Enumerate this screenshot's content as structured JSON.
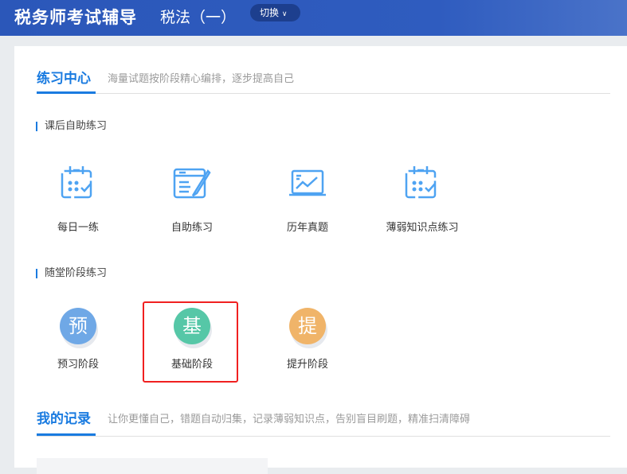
{
  "header": {
    "brand": "税务师考试辅导",
    "subject": "税法（一）",
    "switch_label": "切换"
  },
  "practice": {
    "title": "练习中心",
    "desc": "海量试题按阶段精心编排，逐步提高自己",
    "self_section": "课后自助练习",
    "self_items": [
      {
        "label": "每日一练",
        "icon": "calendar-check-icon"
      },
      {
        "label": "自助练习",
        "icon": "notebook-pen-icon"
      },
      {
        "label": "历年真题",
        "icon": "laptop-chart-icon"
      },
      {
        "label": "薄弱知识点练习",
        "icon": "calendar-check-icon"
      }
    ],
    "stage_section": "随堂阶段练习",
    "stages": [
      {
        "label": "预习阶段",
        "glyph": "预",
        "color": "#6fa8e6"
      },
      {
        "label": "基础阶段",
        "glyph": "基",
        "color": "#56c7a7"
      },
      {
        "label": "提升阶段",
        "glyph": "提",
        "color": "#f0b469"
      }
    ]
  },
  "records": {
    "title": "我的记录",
    "desc": "让你更懂自己，错题自动归集，记录薄弱知识点，告别盲目刷题，精准扫清障碍"
  }
}
